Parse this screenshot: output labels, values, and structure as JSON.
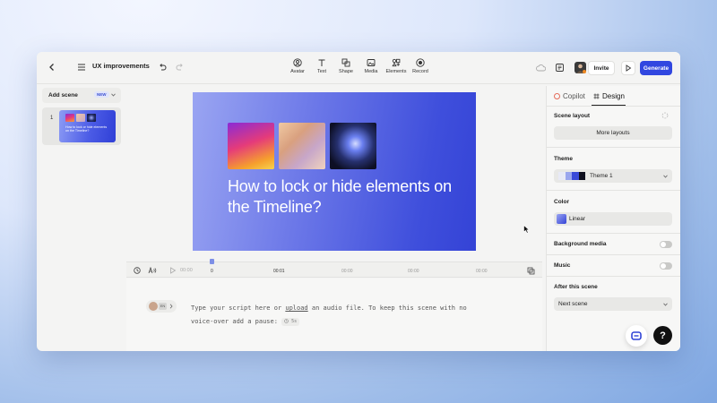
{
  "topbar": {
    "doc_title": "UX improvements",
    "tools": [
      "Avatar",
      "Text",
      "Shape",
      "Media",
      "Elements",
      "Record"
    ],
    "invite_label": "Invite",
    "generate_label": "Generate",
    "accent": "#3147e0"
  },
  "left_panel": {
    "add_scene_label": "Add scene",
    "new_badge": "NEW",
    "scenes": [
      {
        "number": "1",
        "thumb_title": "How to lock or hide elements on the Timeline?"
      }
    ]
  },
  "slide": {
    "title": "How to lock or hide elements on the Timeline?"
  },
  "timeline": {
    "current_time": "00:00",
    "playhead_label": "0",
    "marks": [
      "00:01",
      "00:00",
      "00:00",
      "00:00"
    ]
  },
  "script": {
    "before_link": "Type your script here or ",
    "link": "upload",
    "after_link": " an audio file. To keep this scene with no voice-over add a pause:",
    "pause_chip": "5s",
    "language_badge": "EN"
  },
  "right_panel": {
    "tabs": [
      "Copilot",
      "Design"
    ],
    "active_tab": "Design",
    "scene_layout_label": "Scene layout",
    "more_layouts_label": "More layouts",
    "theme_label": "Theme",
    "theme_value": "Theme 1",
    "color_label": "Color",
    "color_value": "Linear",
    "background_media_label": "Background media",
    "music_label": "Music",
    "after_scene_label": "After this scene",
    "after_scene_value": "Next scene"
  },
  "help": {
    "label": "?"
  }
}
